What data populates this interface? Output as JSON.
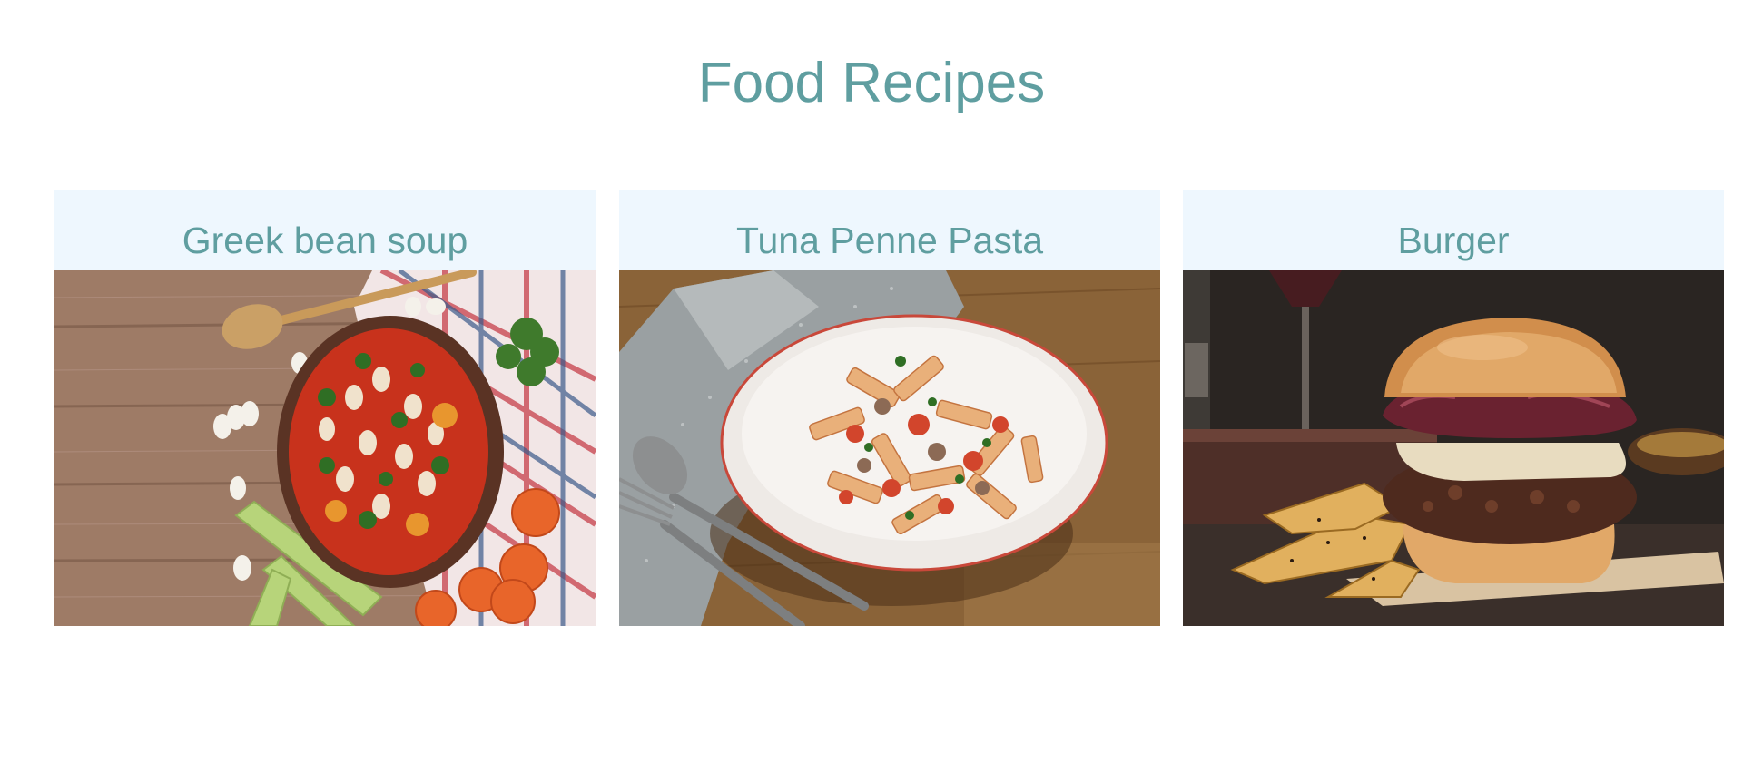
{
  "page": {
    "title": "Food Recipes"
  },
  "recipes": [
    {
      "title": "Greek bean soup"
    },
    {
      "title": "Tuna Penne Pasta"
    },
    {
      "title": "Burger"
    }
  ],
  "colors": {
    "accent": "#5f9ea0",
    "card_header_bg": "#eef7fe"
  }
}
